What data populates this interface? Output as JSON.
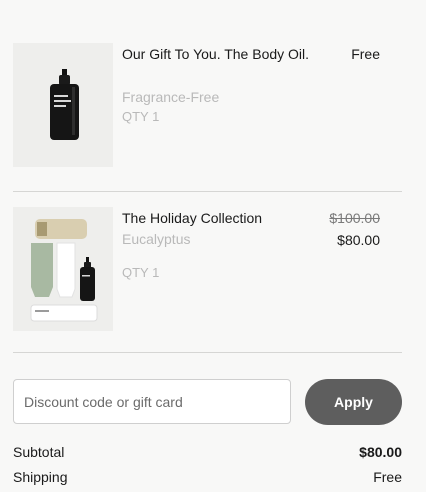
{
  "cart": {
    "items": [
      {
        "name": "Our Gift To You. The Body Oil.",
        "variant": "Fragrance-Free",
        "quantity": "QTY 1",
        "price": "Free"
      },
      {
        "name": "The Holiday Collection",
        "variant": "Eucalyptus",
        "quantity": "QTY 1",
        "original_price": "$100.00",
        "price": "$80.00"
      }
    ]
  },
  "discount": {
    "placeholder": "Discount code or gift card",
    "value": "",
    "apply_label": "Apply"
  },
  "summary": {
    "subtotal_label": "Subtotal",
    "subtotal_value": "$80.00",
    "shipping_label": "Shipping",
    "shipping_value": "Free"
  },
  "colors": {
    "background": "#f8f8f7",
    "apply_button": "#5e5e5e",
    "muted_text": "#b9b9b9"
  }
}
